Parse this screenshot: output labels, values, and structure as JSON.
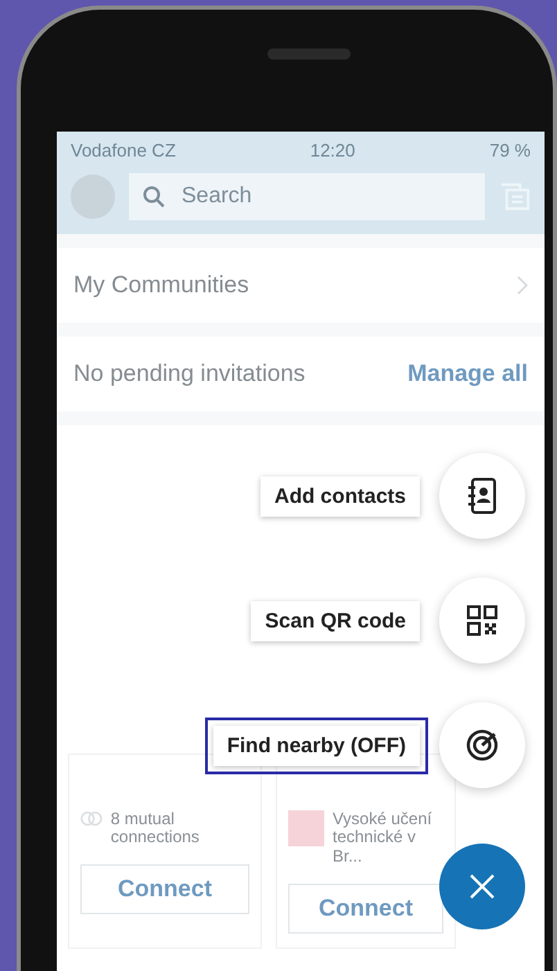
{
  "status_bar": {
    "carrier": "Vodafone CZ",
    "time": "12:20",
    "battery": "79 %"
  },
  "header": {
    "search": {
      "placeholder": "Search"
    }
  },
  "rows": [
    {
      "label": "My Communities",
      "action": ""
    },
    {
      "label": "No pending invitations",
      "action": "Manage all"
    }
  ],
  "cards": [
    {
      "detail": "8 mutual connections",
      "kind": "mutual",
      "button": "Connect"
    },
    {
      "detail": "Vysoké učení technické v Br...",
      "kind": "school",
      "button": "Connect"
    }
  ],
  "fab_menu": {
    "expanded": true,
    "items": [
      {
        "label": "Add contacts",
        "focused": false
      },
      {
        "label": "Scan QR code",
        "focused": false
      },
      {
        "label": "Find nearby (OFF)",
        "focused": true
      }
    ]
  }
}
